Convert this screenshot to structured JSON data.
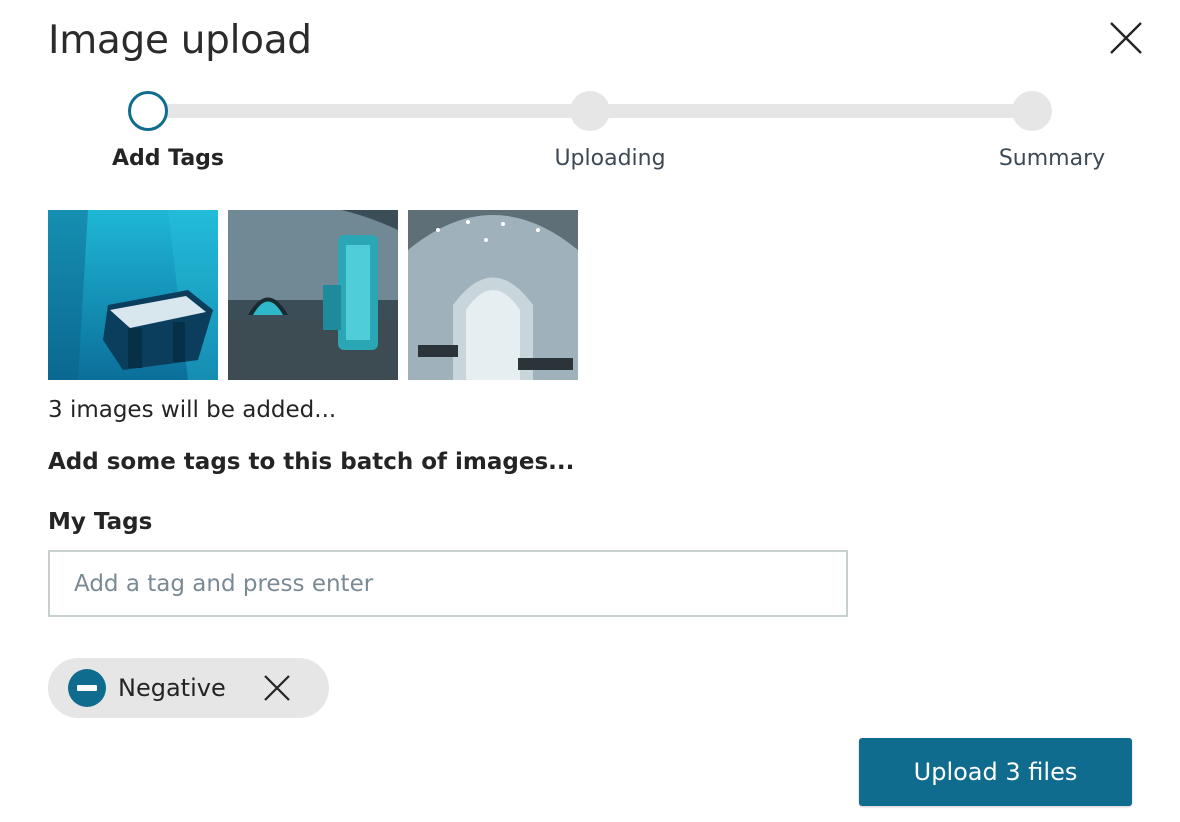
{
  "dialog": {
    "title": "Image upload",
    "close_icon": "close-icon"
  },
  "stepper": {
    "steps": [
      {
        "label": "Add Tags",
        "state": "active"
      },
      {
        "label": "Uploading",
        "state": "pending"
      },
      {
        "label": "Summary",
        "state": "pending"
      }
    ]
  },
  "images": [
    {
      "alt": "Ice hotel room with blue lighting",
      "palette": "cyan"
    },
    {
      "alt": "Ice hallway with glowing column",
      "palette": "teal"
    },
    {
      "alt": "Ice chapel with arched window",
      "palette": "pale"
    }
  ],
  "batch": {
    "count_text": "3 images will be added...",
    "prompt": "Add some tags to this batch of images..."
  },
  "tags": {
    "label": "My Tags",
    "input_placeholder": "Add a tag and press enter",
    "input_value": "",
    "chips": [
      {
        "label": "Negative",
        "icon": "minus-circle-icon",
        "remove_icon": "close-icon"
      }
    ]
  },
  "actions": {
    "upload_label": "Upload 3 files"
  },
  "colors": {
    "accent": "#0f6c8f",
    "track": "#e6e6e6",
    "chip_bg": "#e6e6e6"
  }
}
